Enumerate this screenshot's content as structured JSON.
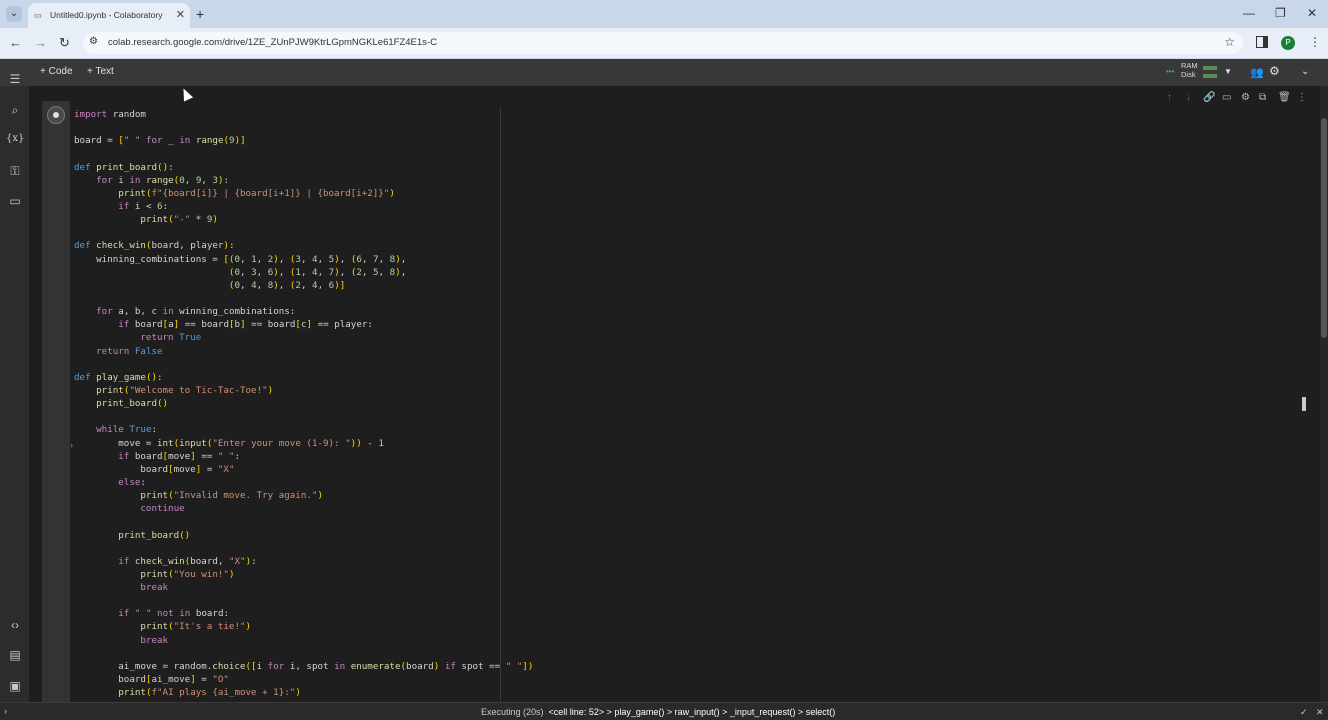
{
  "browser": {
    "tab_title": "Untitled0.ipynb - Colaboratory",
    "url": "colab.research.google.com/drive/1ZE_ZUnPJW9KtrLGpmNGKLe61FZ4E1s-C",
    "profile_initial": "P"
  },
  "toolbar": {
    "code_label": "+ Code",
    "text_label": "+ Text",
    "ram_label": "RAM",
    "disk_label": "Disk"
  },
  "code_lines": [
    "import random",
    "",
    "board = [\" \" for _ in range(9)]",
    "",
    "def print_board():",
    "    for i in range(0, 9, 3):",
    "        print(f\"{board[i]} | {board[i+1]} | {board[i+2]}\")",
    "        if i < 6:",
    "            print(\"-\" * 9)",
    "",
    "def check_win(board, player):",
    "    winning_combinations = [(0, 1, 2), (3, 4, 5), (6, 7, 8),",
    "                            (0, 3, 6), (1, 4, 7), (2, 5, 8),",
    "                            (0, 4, 8), (2, 4, 6)]",
    "",
    "    for a, b, c in winning_combinations:",
    "        if board[a] == board[b] == board[c] == player:",
    "            return True",
    "    return False",
    "",
    "def play_game():",
    "    print(\"Welcome to Tic-Tac-Toe!\")",
    "    print_board()",
    "",
    "    while True:",
    "        move = int(input(\"Enter your move (1-9): \")) - 1",
    "        if board[move] == \" \":",
    "            board[move] = \"X\"",
    "        else:",
    "            print(\"Invalid move. Try again.\")",
    "            continue",
    "",
    "        print_board()",
    "",
    "        if check_win(board, \"X\"):",
    "            print(\"You win!\")",
    "            break",
    "",
    "        if \" \" not in board:",
    "            print(\"It's a tie!\")",
    "            break",
    "",
    "        ai_move = random.choice([i for i, spot in enumerate(board) if spot == \" \"])",
    "        board[ai_move] = \"O\"",
    "        print(f\"AI plays {ai_move + 1}:\")"
  ],
  "status": {
    "executing": "Executing (20s)",
    "trace": "<cell line: 52> > play_game() > raw_input() > _input_request() > select()"
  }
}
